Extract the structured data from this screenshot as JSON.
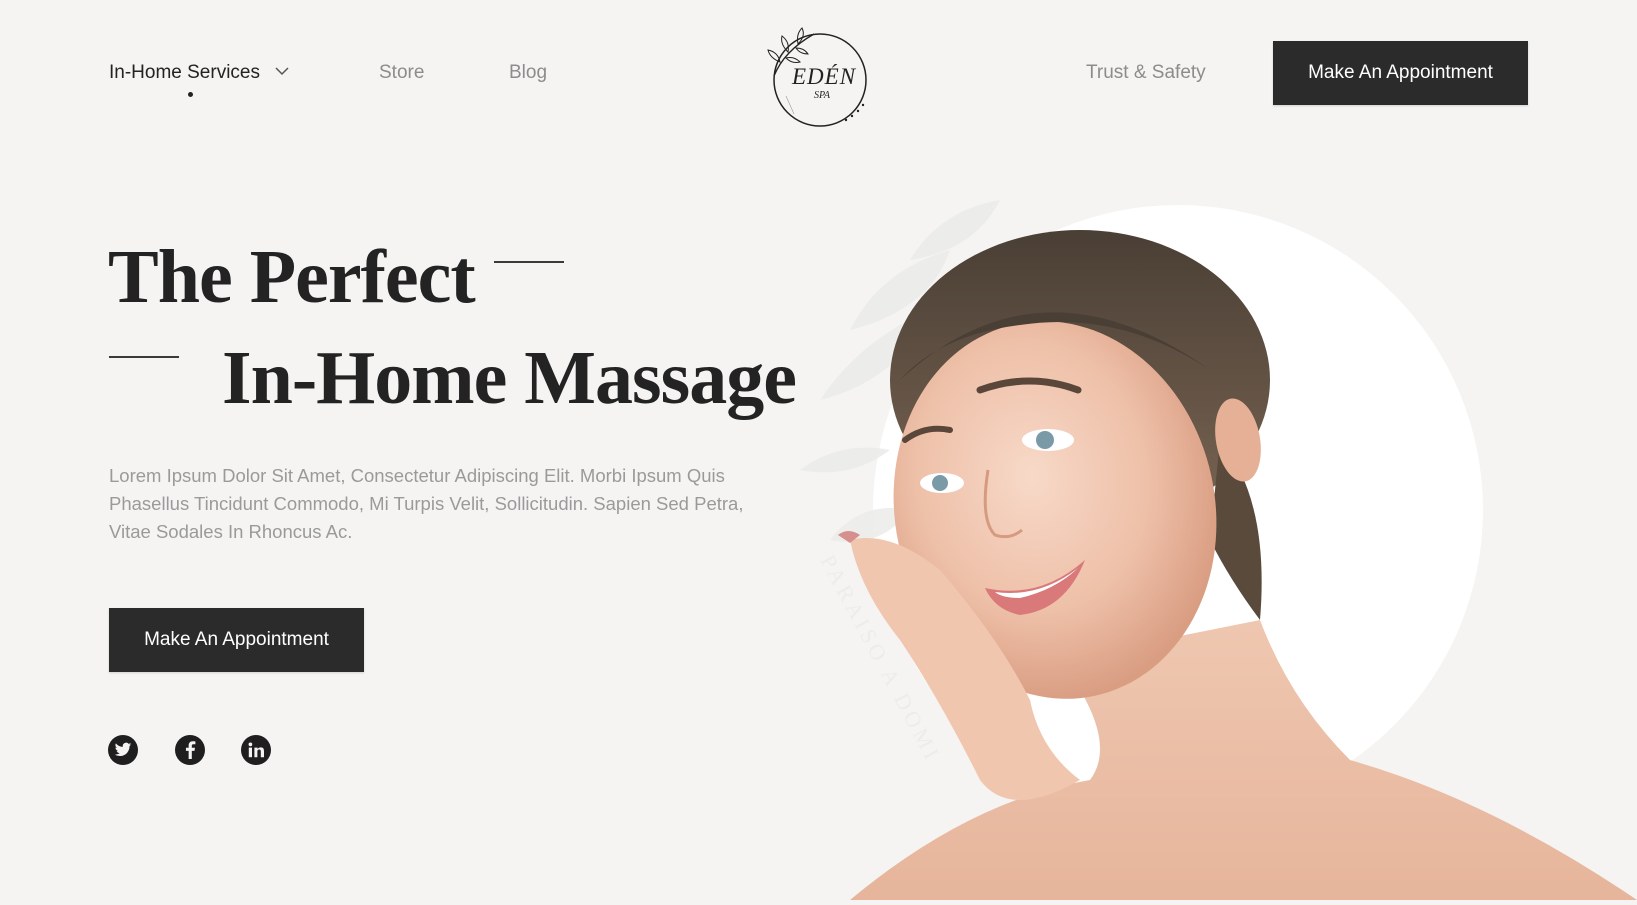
{
  "nav": {
    "services_label": "In-Home Services",
    "store_label": "Store",
    "blog_label": "Blog",
    "trust_label": "Trust & Safety",
    "cta_label": "Make An Appointment"
  },
  "logo": {
    "name": "EDÉN",
    "sub": "SPA"
  },
  "hero": {
    "title_line1": "The Perfect",
    "title_line2": "In-Home Massage",
    "description": "Lorem Ipsum Dolor Sit Amet, Consectetur Adipiscing Elit. Morbi Ipsum Quis Phasellus Tincidunt Commodo, Mi Turpis Velit, Sollicitudin. Sapien Sed Petra, Vitae Sodales In Rhoncus Ac.",
    "cta_label": "Make An Appointment",
    "image_caption": "PARAISO A DOMI"
  },
  "social": [
    "twitter-icon",
    "facebook-icon",
    "linkedin-icon"
  ],
  "colors": {
    "background": "#f5f4f2",
    "button": "#2b2b2b",
    "text": "#232323",
    "muted": "#8c8c8c"
  }
}
